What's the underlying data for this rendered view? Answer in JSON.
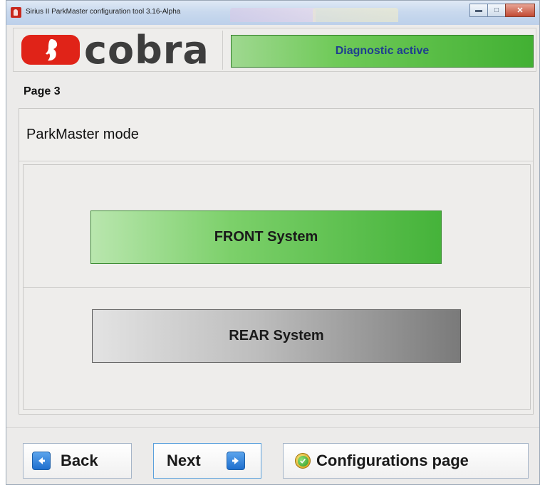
{
  "window": {
    "title": "Sirius II ParkMaster configuration tool  3.16-Alpha"
  },
  "header": {
    "logo_text": "cobra",
    "status": "Diagnostic active",
    "status_color": "#42b033",
    "brand_color": "#e02318"
  },
  "page": {
    "number_label": "Page 3",
    "mode_title": "ParkMaster mode"
  },
  "options": {
    "front_label": "FRONT System",
    "rear_label": "REAR System",
    "front_color": "#45b33a",
    "rear_color": "#7a7a7a"
  },
  "footer": {
    "back_label": "Back",
    "next_label": "Next",
    "config_label": "Configurations page"
  },
  "icons": {
    "back": "arrow-left-icon",
    "next": "arrow-right-icon",
    "config": "check-circle-icon",
    "app": "cobra-app-icon"
  }
}
